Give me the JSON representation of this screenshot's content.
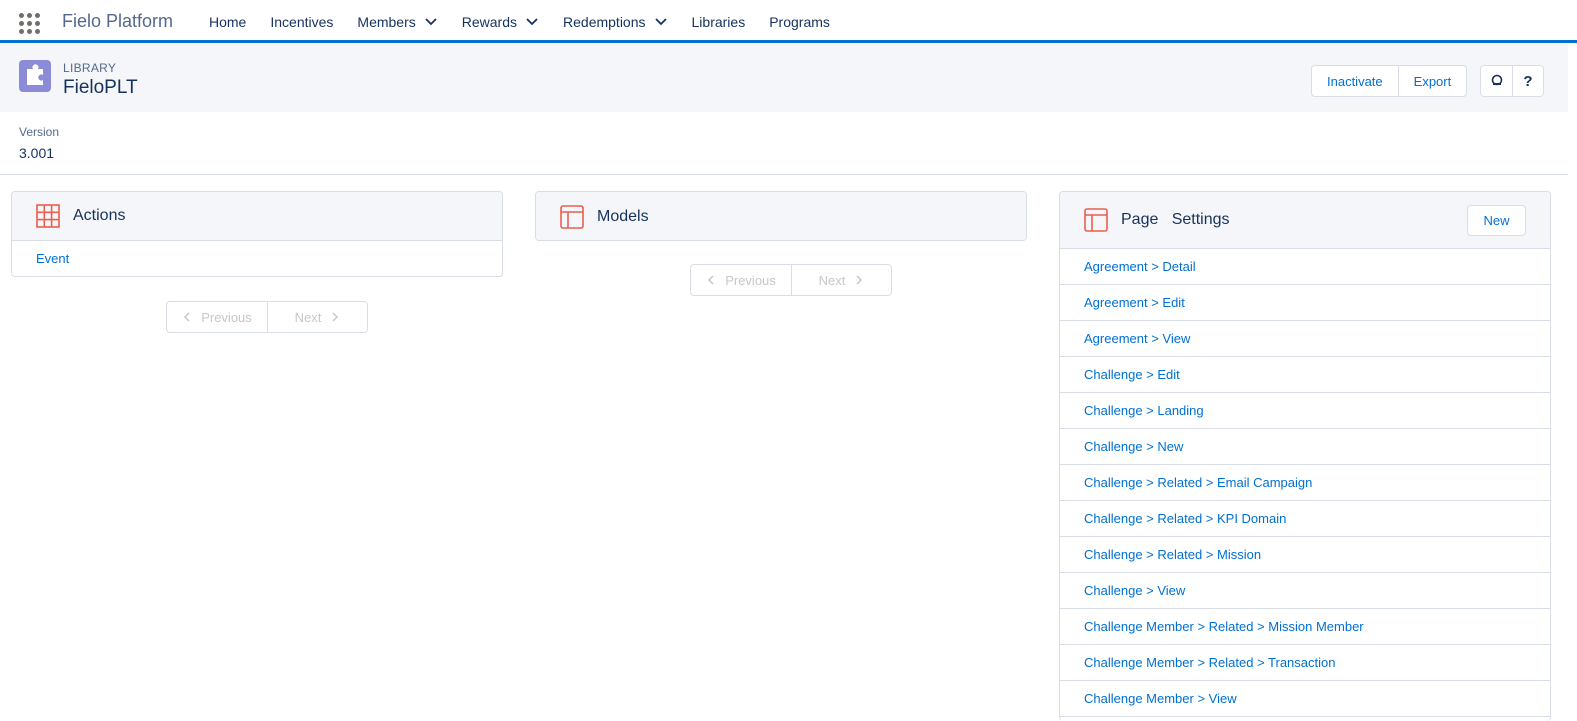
{
  "app": {
    "name": "Fielo Platform"
  },
  "nav": {
    "items": [
      {
        "label": "Home",
        "dropdown": false
      },
      {
        "label": "Incentives",
        "dropdown": false
      },
      {
        "label": "Members",
        "dropdown": true
      },
      {
        "label": "Rewards",
        "dropdown": true
      },
      {
        "label": "Redemptions",
        "dropdown": true
      },
      {
        "label": "Libraries",
        "dropdown": false
      },
      {
        "label": "Programs",
        "dropdown": false
      }
    ]
  },
  "header": {
    "object_type": "Library",
    "record_name": "FieloPLT",
    "actions": {
      "inactivate": "Inactivate",
      "export": "Export"
    }
  },
  "detail": {
    "version_label": "Version",
    "version_value": "3.001"
  },
  "actions_card": {
    "title": "Actions",
    "items": [
      "Event"
    ],
    "pager": {
      "previous": "Previous",
      "next": "Next"
    }
  },
  "models_card": {
    "title": "Models",
    "pager": {
      "previous": "Previous",
      "next": "Next"
    }
  },
  "page_settings_card": {
    "title": "Page   Settings",
    "new_label": "New",
    "items": [
      "Agreement > Detail",
      "Agreement > Edit",
      "Agreement > View",
      "Challenge > Edit",
      "Challenge > Landing",
      "Challenge > New",
      "Challenge > Related > Email Campaign",
      "Challenge > Related > KPI Domain",
      "Challenge > Related > Mission",
      "Challenge > View",
      "Challenge Member > Related > Mission Member",
      "Challenge Member > Related > Transaction",
      "Challenge Member > View"
    ]
  },
  "colors": {
    "brand": "#0070d2",
    "card_icon": "#ea5f4e",
    "library_icon": "#8b8bd8"
  }
}
